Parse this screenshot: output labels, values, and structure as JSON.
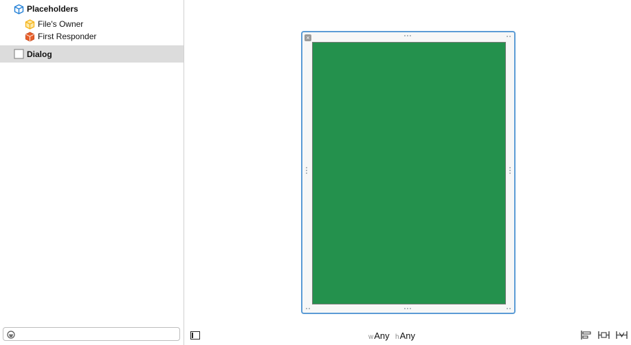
{
  "outline": {
    "placeholders_label": "Placeholders",
    "items": [
      {
        "label": "File's Owner"
      },
      {
        "label": "First Responder"
      }
    ],
    "dialog_label": "Dialog"
  },
  "bottom_bar": {
    "width_prefix": "w",
    "width_value": "Any",
    "height_prefix": "h",
    "height_value": "Any"
  },
  "colors": {
    "scene_fill": "#24914d",
    "selection_border": "#5b9bd5",
    "placeholder_icon": "#1f7ed6",
    "owner_icon": "#f5b31a",
    "responder_icon": "#e8612c"
  },
  "icons": [
    "cube-icon",
    "files-owner-icon",
    "first-responder-icon",
    "view-icon",
    "filter-icon",
    "toggle-outline-icon",
    "align-icon",
    "pin-icon",
    "resolve-icon"
  ]
}
